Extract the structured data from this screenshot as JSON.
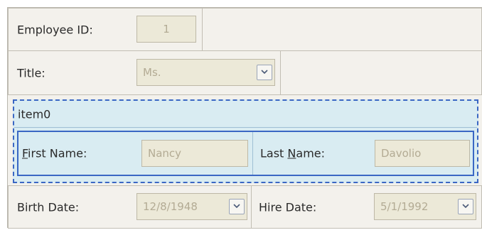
{
  "employee_id": {
    "label": "Employee ID:",
    "value": "1"
  },
  "title": {
    "label": "Title:",
    "value": "Ms."
  },
  "group": {
    "caption": "item0"
  },
  "first_name": {
    "label_mnemonic": "F",
    "label_rest": "irst Name:",
    "value": "Nancy"
  },
  "last_name": {
    "label_prefix": "Last ",
    "label_mnemonic": "N",
    "label_rest": "ame:",
    "value": "Davolio"
  },
  "birth_date": {
    "label": "Birth Date:",
    "value": "12/8/1948"
  },
  "hire_date": {
    "label": "Hire Date:",
    "value": "5/1/1992"
  },
  "icons": {
    "dropdown": "chevron-down-icon"
  },
  "colors": {
    "group_border": "#3a67c4",
    "group_bg": "#d9ecf2",
    "disabled_text": "#b3ab94"
  }
}
